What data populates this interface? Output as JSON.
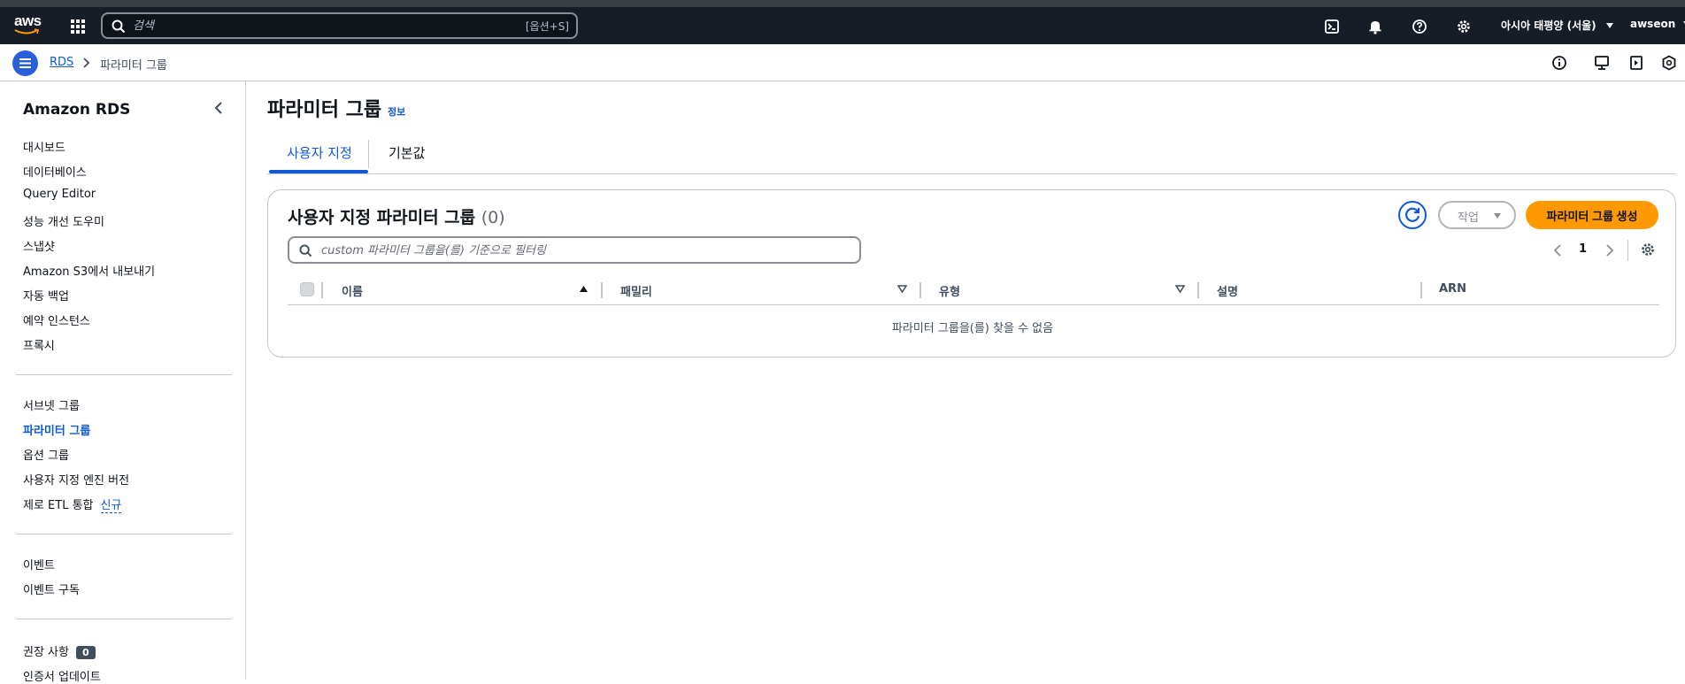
{
  "topnav": {
    "logo_text": "aws",
    "search_placeholder": "검색",
    "search_shortcut": "[옵션+S]",
    "region": "아시아 태평양 (서울)",
    "user": "awseon",
    "icons": [
      "cloudshell-icon",
      "bell-icon",
      "help-icon",
      "gear-icon"
    ]
  },
  "breadcrumb": {
    "items": [
      "RDS",
      "파라미터 그룹"
    ]
  },
  "sidebar": {
    "title": "Amazon RDS",
    "group1": [
      "대시보드",
      "데이터베이스",
      "Query Editor",
      "성능 개선 도우미",
      "스냅샷",
      "Amazon S3에서 내보내기",
      "자동 백업",
      "예약 인스턴스",
      "프록시"
    ],
    "group2": [
      "서브넷 그룹",
      "파라미터 그룹",
      "옵션 그룹",
      "사용자 지정 엔진 버전",
      "제로 ETL 통합"
    ],
    "new_tag": "신규",
    "group3": [
      "이벤트",
      "이벤트 구독"
    ],
    "group4": [
      "권장 사항",
      "인증서 업데이트"
    ],
    "recommendations_count": "0",
    "active_item": "파라미터 그룹"
  },
  "main": {
    "title": "파라미터 그룹",
    "info_link": "정보",
    "tabs": [
      {
        "label": "사용자 지정",
        "active": true
      },
      {
        "label": "기본값",
        "active": false
      }
    ],
    "container": {
      "title": "사용자 지정 파라미터 그룹",
      "count": "(0)",
      "action_button": "작업",
      "create_button": "파라미터 그룹 생성",
      "filter_placeholder": "custom 파라미터 그룹을(를) 기준으로 필터링",
      "page": "1",
      "columns": [
        "이름",
        "패밀리",
        "유형",
        "설명",
        "ARN"
      ],
      "empty_message": "파라미터 그룹을(를) 찾을 수 없음"
    }
  },
  "colors": {
    "nav_bg": "#161d26",
    "link": "#0f5bd6",
    "primary_button": "#ff9900",
    "border": "#c6c6cd"
  }
}
